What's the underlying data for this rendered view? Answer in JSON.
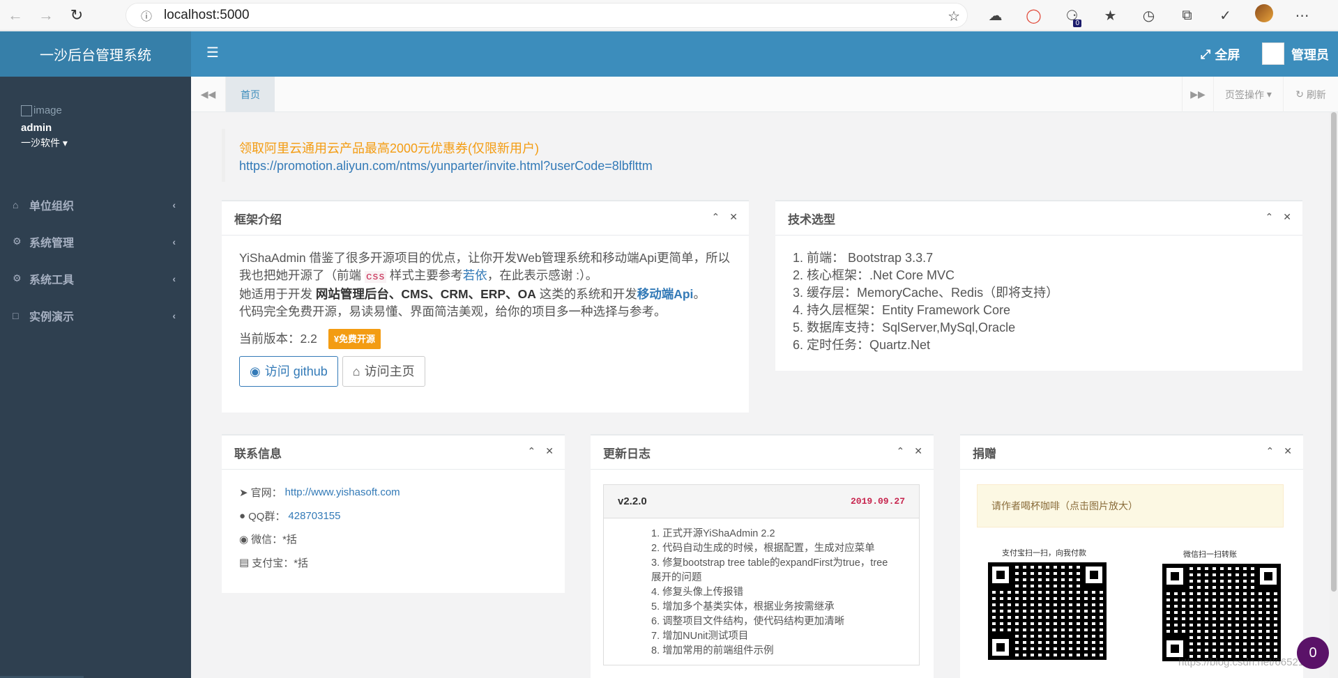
{
  "browser": {
    "url": "localhost:5000",
    "back_icon": "arrow-left-icon",
    "forward_icon": "arrow-right-icon",
    "reload_icon": "reload-icon",
    "extension_badge": "0"
  },
  "sidebar": {
    "brand": "一沙后台管理系统",
    "profile": {
      "image_alt": "image",
      "name": "admin",
      "org": "一沙软件"
    },
    "menu": [
      {
        "label": "单位组织",
        "icon": "home-icon"
      },
      {
        "label": "系统管理",
        "icon": "gear-icon"
      },
      {
        "label": "系统工具",
        "icon": "gears-icon"
      },
      {
        "label": "实例演示",
        "icon": "square-icon"
      }
    ]
  },
  "header": {
    "fullscreen_label": "全屏",
    "admin_label": "管理员"
  },
  "tabs": {
    "home_label": "首页",
    "ops_label": "页签操作",
    "refresh_label": "刷新"
  },
  "promo": {
    "text": "领取阿里云通用云产品最高2000元优惠券(仅限新用户)",
    "link": "https://promotion.aliyun.com/ntms/yunparter/invite.html?userCode=8lbflttm"
  },
  "intro": {
    "title": "框架介绍",
    "line1_pre": "YiShaAdmin 借鉴了很多开源项目的优点，让你开发Web管理系统和移动端Api更简单，所以我也把她开源了（前端",
    "line1_code": "css",
    "line1_mid": "样式主要参考",
    "line1_link": "若依",
    "line1_post": "，在此表示感谢 :）。",
    "line2_pre": "她适用于开发",
    "line2_strong": "网站管理后台、CMS、CRM、ERP、OA",
    "line2_mid": "这类的系统和开发",
    "line2_link": "移动端Api",
    "line2_post": "。",
    "line3": "代码完全免费开源，易读易懂、界面简洁美观，给你的项目多一种选择与参考。",
    "version_label": "当前版本：2.2",
    "badge": "¥免费开源",
    "github_btn": "访问 github",
    "home_btn": "访问主页"
  },
  "tech": {
    "title": "技术选型",
    "items": [
      "1. 前端： Bootstrap 3.3.7",
      "2. 核心框架：.Net Core MVC",
      "3. 缓存层：MemoryCache、Redis（即将支持）",
      "4. 持久层框架：Entity Framework Core",
      "5. 数据库支持：SqlServer,MySql,Oracle",
      "6. 定时任务：Quartz.Net"
    ]
  },
  "contact": {
    "title": "联系信息",
    "website_label": "官网：",
    "website": "http://www.yishasoft.com",
    "qq_label": "QQ群：",
    "qq": "428703155",
    "wechat": "微信：*括",
    "alipay": "支付宝：*括"
  },
  "changelog": {
    "title": "更新日志",
    "version": "v2.2.0",
    "date": "2019.09.27",
    "items": [
      "1. 正式开源YiShaAdmin 2.2",
      "2. 代码自动生成的时候，根据配置，生成对应菜单",
      "3. 修复bootstrap tree table的expandFirst为true，tree展开的问题",
      "4. 修复头像上传报错",
      "5. 增加多个基类实体，根据业务按需继承",
      "6. 调整项目文件结构，使代码结构更加清晰",
      "7. 增加NUnit测试项目",
      "8. 增加常用的前端组件示例"
    ]
  },
  "donate": {
    "title": "捐赠",
    "note": "请作者喝杯咖啡（点击图片放大）",
    "alipay_label": "支付宝扫一扫，向我付款",
    "wechat_label": "微信扫一扫转账"
  },
  "chat_count": "0",
  "watermark": "https://blog.csdn.net/6652180"
}
